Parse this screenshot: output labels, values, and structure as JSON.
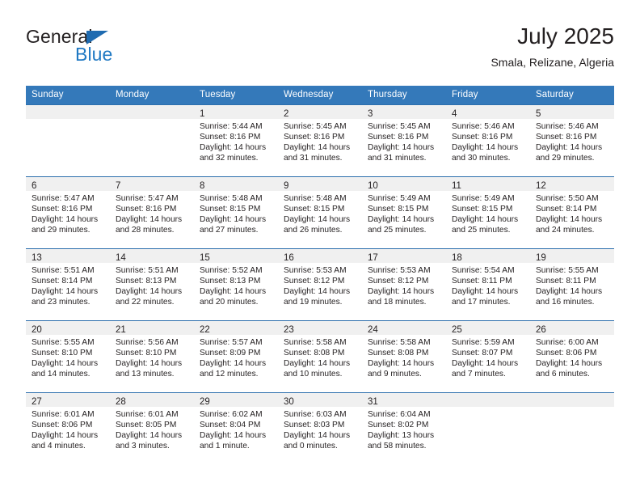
{
  "brand": {
    "name_top": "General",
    "name_bottom": "Blue",
    "triangle_icon": "brand-triangle-icon",
    "colors": {
      "blue": "#2079c3",
      "dark": "#231f20"
    }
  },
  "header": {
    "title": "July 2025",
    "subtitle": "Smala, Relizane, Algeria"
  },
  "theme": {
    "header_row_bg": "#3479ba",
    "week_border": "#2d6fad",
    "daynum_band_bg": "#f0f0f0",
    "text": "#231f20"
  },
  "calendar": {
    "weekday_headers": [
      "Sunday",
      "Monday",
      "Tuesday",
      "Wednesday",
      "Thursday",
      "Friday",
      "Saturday"
    ],
    "weeks": [
      [
        {
          "day": "",
          "sunrise": "",
          "sunset": "",
          "daylight_line1": "",
          "daylight_line2": ""
        },
        {
          "day": "",
          "sunrise": "",
          "sunset": "",
          "daylight_line1": "",
          "daylight_line2": ""
        },
        {
          "day": "1",
          "sunrise": "Sunrise: 5:44 AM",
          "sunset": "Sunset: 8:16 PM",
          "daylight_line1": "Daylight: 14 hours",
          "daylight_line2": "and 32 minutes."
        },
        {
          "day": "2",
          "sunrise": "Sunrise: 5:45 AM",
          "sunset": "Sunset: 8:16 PM",
          "daylight_line1": "Daylight: 14 hours",
          "daylight_line2": "and 31 minutes."
        },
        {
          "day": "3",
          "sunrise": "Sunrise: 5:45 AM",
          "sunset": "Sunset: 8:16 PM",
          "daylight_line1": "Daylight: 14 hours",
          "daylight_line2": "and 31 minutes."
        },
        {
          "day": "4",
          "sunrise": "Sunrise: 5:46 AM",
          "sunset": "Sunset: 8:16 PM",
          "daylight_line1": "Daylight: 14 hours",
          "daylight_line2": "and 30 minutes."
        },
        {
          "day": "5",
          "sunrise": "Sunrise: 5:46 AM",
          "sunset": "Sunset: 8:16 PM",
          "daylight_line1": "Daylight: 14 hours",
          "daylight_line2": "and 29 minutes."
        }
      ],
      [
        {
          "day": "6",
          "sunrise": "Sunrise: 5:47 AM",
          "sunset": "Sunset: 8:16 PM",
          "daylight_line1": "Daylight: 14 hours",
          "daylight_line2": "and 29 minutes."
        },
        {
          "day": "7",
          "sunrise": "Sunrise: 5:47 AM",
          "sunset": "Sunset: 8:16 PM",
          "daylight_line1": "Daylight: 14 hours",
          "daylight_line2": "and 28 minutes."
        },
        {
          "day": "8",
          "sunrise": "Sunrise: 5:48 AM",
          "sunset": "Sunset: 8:15 PM",
          "daylight_line1": "Daylight: 14 hours",
          "daylight_line2": "and 27 minutes."
        },
        {
          "day": "9",
          "sunrise": "Sunrise: 5:48 AM",
          "sunset": "Sunset: 8:15 PM",
          "daylight_line1": "Daylight: 14 hours",
          "daylight_line2": "and 26 minutes."
        },
        {
          "day": "10",
          "sunrise": "Sunrise: 5:49 AM",
          "sunset": "Sunset: 8:15 PM",
          "daylight_line1": "Daylight: 14 hours",
          "daylight_line2": "and 25 minutes."
        },
        {
          "day": "11",
          "sunrise": "Sunrise: 5:49 AM",
          "sunset": "Sunset: 8:15 PM",
          "daylight_line1": "Daylight: 14 hours",
          "daylight_line2": "and 25 minutes."
        },
        {
          "day": "12",
          "sunrise": "Sunrise: 5:50 AM",
          "sunset": "Sunset: 8:14 PM",
          "daylight_line1": "Daylight: 14 hours",
          "daylight_line2": "and 24 minutes."
        }
      ],
      [
        {
          "day": "13",
          "sunrise": "Sunrise: 5:51 AM",
          "sunset": "Sunset: 8:14 PM",
          "daylight_line1": "Daylight: 14 hours",
          "daylight_line2": "and 23 minutes."
        },
        {
          "day": "14",
          "sunrise": "Sunrise: 5:51 AM",
          "sunset": "Sunset: 8:13 PM",
          "daylight_line1": "Daylight: 14 hours",
          "daylight_line2": "and 22 minutes."
        },
        {
          "day": "15",
          "sunrise": "Sunrise: 5:52 AM",
          "sunset": "Sunset: 8:13 PM",
          "daylight_line1": "Daylight: 14 hours",
          "daylight_line2": "and 20 minutes."
        },
        {
          "day": "16",
          "sunrise": "Sunrise: 5:53 AM",
          "sunset": "Sunset: 8:12 PM",
          "daylight_line1": "Daylight: 14 hours",
          "daylight_line2": "and 19 minutes."
        },
        {
          "day": "17",
          "sunrise": "Sunrise: 5:53 AM",
          "sunset": "Sunset: 8:12 PM",
          "daylight_line1": "Daylight: 14 hours",
          "daylight_line2": "and 18 minutes."
        },
        {
          "day": "18",
          "sunrise": "Sunrise: 5:54 AM",
          "sunset": "Sunset: 8:11 PM",
          "daylight_line1": "Daylight: 14 hours",
          "daylight_line2": "and 17 minutes."
        },
        {
          "day": "19",
          "sunrise": "Sunrise: 5:55 AM",
          "sunset": "Sunset: 8:11 PM",
          "daylight_line1": "Daylight: 14 hours",
          "daylight_line2": "and 16 minutes."
        }
      ],
      [
        {
          "day": "20",
          "sunrise": "Sunrise: 5:55 AM",
          "sunset": "Sunset: 8:10 PM",
          "daylight_line1": "Daylight: 14 hours",
          "daylight_line2": "and 14 minutes."
        },
        {
          "day": "21",
          "sunrise": "Sunrise: 5:56 AM",
          "sunset": "Sunset: 8:10 PM",
          "daylight_line1": "Daylight: 14 hours",
          "daylight_line2": "and 13 minutes."
        },
        {
          "day": "22",
          "sunrise": "Sunrise: 5:57 AM",
          "sunset": "Sunset: 8:09 PM",
          "daylight_line1": "Daylight: 14 hours",
          "daylight_line2": "and 12 minutes."
        },
        {
          "day": "23",
          "sunrise": "Sunrise: 5:58 AM",
          "sunset": "Sunset: 8:08 PM",
          "daylight_line1": "Daylight: 14 hours",
          "daylight_line2": "and 10 minutes."
        },
        {
          "day": "24",
          "sunrise": "Sunrise: 5:58 AM",
          "sunset": "Sunset: 8:08 PM",
          "daylight_line1": "Daylight: 14 hours",
          "daylight_line2": "and 9 minutes."
        },
        {
          "day": "25",
          "sunrise": "Sunrise: 5:59 AM",
          "sunset": "Sunset: 8:07 PM",
          "daylight_line1": "Daylight: 14 hours",
          "daylight_line2": "and 7 minutes."
        },
        {
          "day": "26",
          "sunrise": "Sunrise: 6:00 AM",
          "sunset": "Sunset: 8:06 PM",
          "daylight_line1": "Daylight: 14 hours",
          "daylight_line2": "and 6 minutes."
        }
      ],
      [
        {
          "day": "27",
          "sunrise": "Sunrise: 6:01 AM",
          "sunset": "Sunset: 8:06 PM",
          "daylight_line1": "Daylight: 14 hours",
          "daylight_line2": "and 4 minutes."
        },
        {
          "day": "28",
          "sunrise": "Sunrise: 6:01 AM",
          "sunset": "Sunset: 8:05 PM",
          "daylight_line1": "Daylight: 14 hours",
          "daylight_line2": "and 3 minutes."
        },
        {
          "day": "29",
          "sunrise": "Sunrise: 6:02 AM",
          "sunset": "Sunset: 8:04 PM",
          "daylight_line1": "Daylight: 14 hours",
          "daylight_line2": "and 1 minute."
        },
        {
          "day": "30",
          "sunrise": "Sunrise: 6:03 AM",
          "sunset": "Sunset: 8:03 PM",
          "daylight_line1": "Daylight: 14 hours",
          "daylight_line2": "and 0 minutes."
        },
        {
          "day": "31",
          "sunrise": "Sunrise: 6:04 AM",
          "sunset": "Sunset: 8:02 PM",
          "daylight_line1": "Daylight: 13 hours",
          "daylight_line2": "and 58 minutes."
        },
        {
          "day": "",
          "sunrise": "",
          "sunset": "",
          "daylight_line1": "",
          "daylight_line2": ""
        },
        {
          "day": "",
          "sunrise": "",
          "sunset": "",
          "daylight_line1": "",
          "daylight_line2": ""
        }
      ]
    ]
  }
}
